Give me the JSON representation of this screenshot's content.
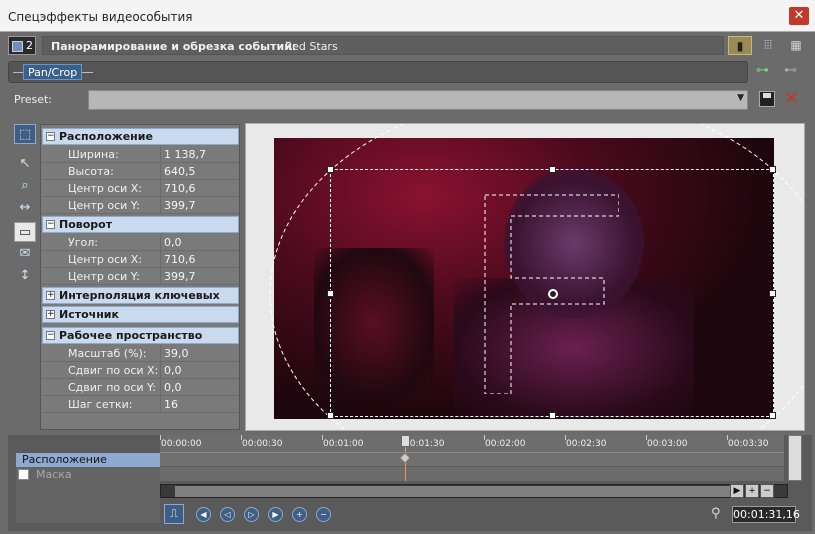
{
  "window": {
    "title": "Спецэффекты видеособытия",
    "close_label": "✕"
  },
  "header": {
    "track_number": "2",
    "label": "Панорамирование и обрезка событий:",
    "value": "Red Stars",
    "view_icons": [
      "view-single-icon",
      "view-columns-icon",
      "view-grid-icon"
    ]
  },
  "chain": {
    "plugin": "Pan/Crop"
  },
  "preset": {
    "label": "Preset:",
    "value": ""
  },
  "tools": [
    "normal-edit-icon",
    "pointer-icon",
    "zoom-icon",
    "move-icon",
    "position-icon",
    "envelope-icon",
    "sync-cursor-icon"
  ],
  "properties": {
    "position": {
      "title": "Расположение",
      "rows": [
        {
          "name": "Ширина:",
          "value": "1 138,7"
        },
        {
          "name": "Высота:",
          "value": "640,5"
        },
        {
          "name": "Центр оси X:",
          "value": "710,6"
        },
        {
          "name": "Центр оси Y:",
          "value": "399,7"
        }
      ]
    },
    "rotation": {
      "title": "Поворот",
      "rows": [
        {
          "name": "Угол:",
          "value": "0,0"
        },
        {
          "name": "Центр оси X:",
          "value": "710,6"
        },
        {
          "name": "Центр оси Y:",
          "value": "399,7"
        }
      ]
    },
    "interpolation": {
      "title": "Интерполяция ключевых ка..."
    },
    "source": {
      "title": "Источник"
    },
    "workspace": {
      "title": "Рабочее пространство",
      "rows": [
        {
          "name": "Масштаб (%):",
          "value": "39,0"
        },
        {
          "name": "Сдвиг по оси X:",
          "value": "0,0"
        },
        {
          "name": "Сдвиг по оси Y:",
          "value": "0,0"
        },
        {
          "name": "Шаг сетки:",
          "value": "16"
        }
      ]
    }
  },
  "timeline": {
    "tracks": [
      "Расположение",
      "Маска"
    ],
    "ticks": [
      "00:00:00",
      "00:00:30",
      "00:01:00",
      "00:01:30",
      "00:02:00",
      "00:02:30",
      "00:03:00",
      "00:03:30"
    ],
    "current_time": "00:01:31,16"
  }
}
